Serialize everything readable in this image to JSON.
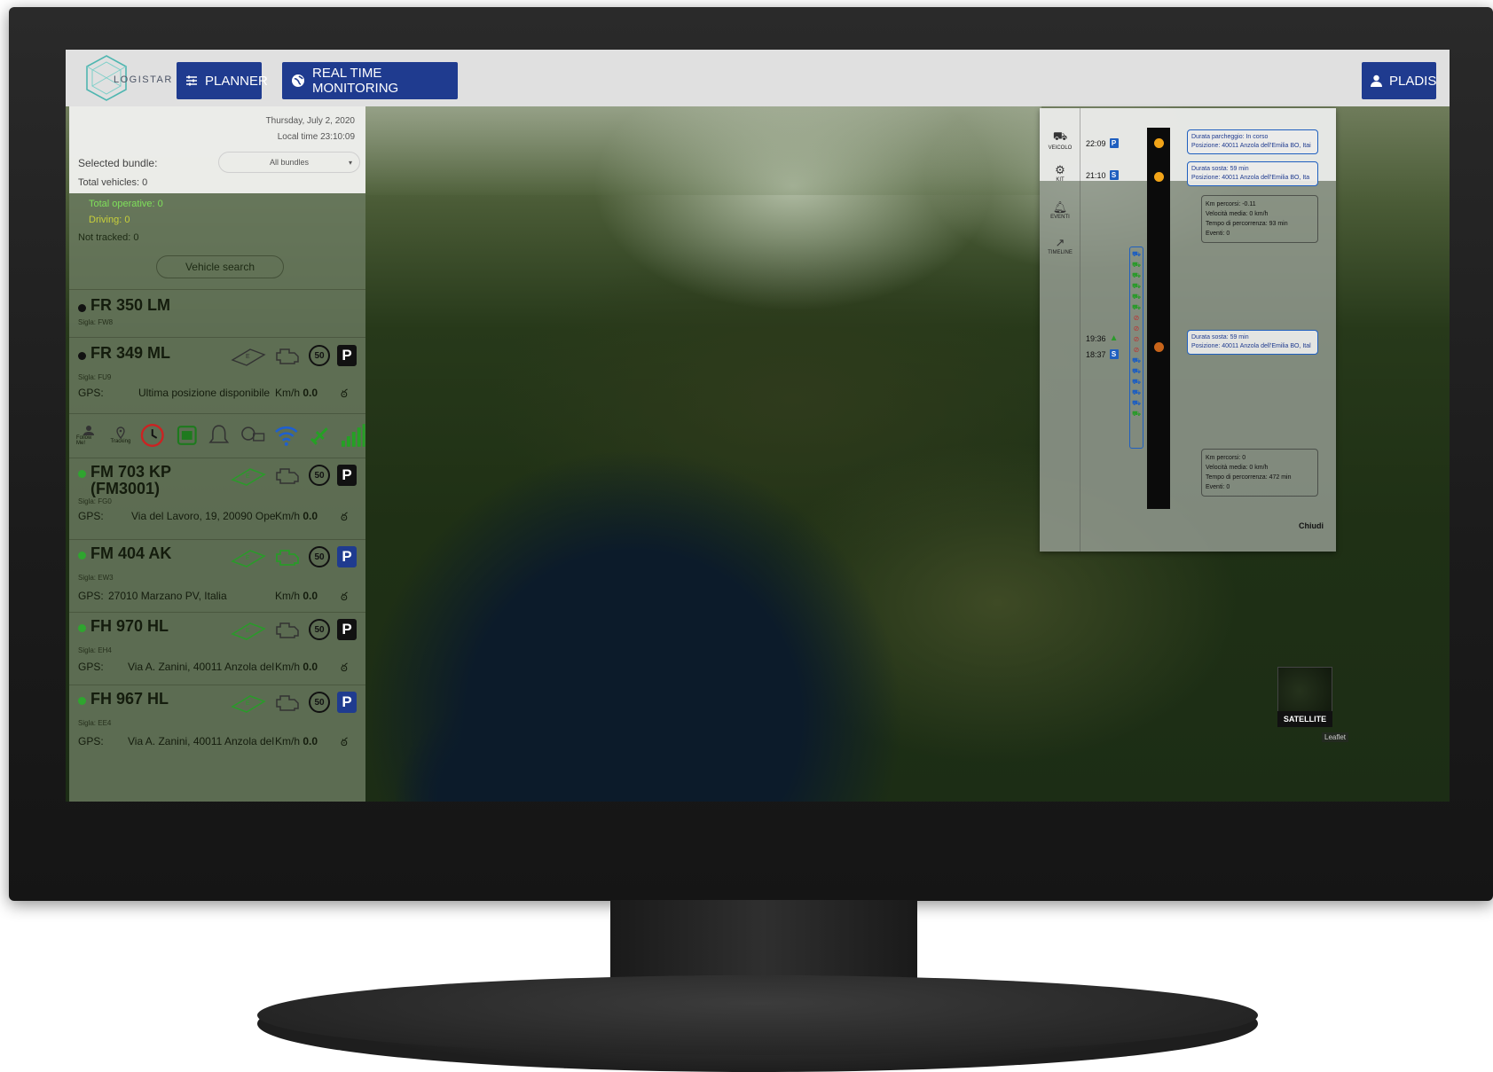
{
  "header": {
    "logo_text": "LOGISTAR",
    "planner_label": "PLANNER",
    "rtm_label": "REAL TIME MONITORING",
    "user_label": "PLADIS"
  },
  "info": {
    "date": "Thursday, July 2, 2020",
    "local_time": "Local time 23:10:09",
    "selected_bundle_label": "Selected bundle:",
    "bundle_value": "All bundles",
    "total_vehicles": "Total vehicles: 0",
    "total_operative": "Total operative: 0",
    "driving": "Driving: 0",
    "not_tracked": "Not tracked: 0",
    "vehicle_search": "Vehicle search"
  },
  "vehicles": [
    {
      "plate": "FR 350 LM",
      "sigla": "Sigla: FW8",
      "status_color": "#111111"
    },
    {
      "plate": "FR 349 ML",
      "sigla": "Sigla: FU9",
      "gps_label": "GPS:",
      "gps_value": "Ultima posizione disponibile",
      "speed_label": "Km/h",
      "speed_value": "0.0",
      "speed_limit": "50",
      "status_color": "#111111"
    },
    {
      "plate": "FM 703 KP",
      "plate_line2": "(FM3001)",
      "sigla": "Sigla: FG0",
      "gps_label": "GPS:",
      "gps_value": "Via del Lavoro, 19, 20090 Ope",
      "speed_label": "Km/h",
      "speed_value": "0.0",
      "speed_limit": "50",
      "status_color": "#2fa52f"
    },
    {
      "plate": "FM 404 AK",
      "sigla": "Sigla: EW3",
      "gps_label": "GPS:",
      "gps_value": "27010 Marzano PV, Italia",
      "speed_label": "Km/h",
      "speed_value": "0.0",
      "speed_limit": "50",
      "status_color": "#2fa52f"
    },
    {
      "plate": "FH 970 HL",
      "sigla": "Sigla: EH4",
      "gps_label": "GPS:",
      "gps_value": "Via A. Zanini, 40011 Anzola del",
      "speed_label": "Km/h",
      "speed_value": "0.0",
      "speed_limit": "50",
      "status_color": "#2fa52f"
    },
    {
      "plate": "FH 967 HL",
      "sigla": "Sigla: EE4",
      "gps_label": "GPS:",
      "gps_value": "Via A. Zanini, 40011 Anzola del",
      "speed_label": "Km/h",
      "speed_value": "0.0",
      "speed_limit": "50",
      "status_color": "#2fa52f"
    }
  ],
  "tools": {
    "follow_me": "Follow Me!",
    "tracking": "Tracking"
  },
  "timeline": {
    "nav": {
      "veicolo": "VEICOLO",
      "kit": "KIT",
      "eventi": "EVENTI",
      "timeline": "TIMELINE"
    },
    "entries": [
      {
        "time": "22:09",
        "badge": "P"
      },
      {
        "time": "21:10",
        "badge": "S"
      },
      {
        "time": "19:36",
        "badge": "▲"
      },
      {
        "time": "18:37",
        "badge": "S"
      }
    ],
    "box1_l1": "Durata parcheggio: In corso",
    "box1_l2": "Posizione: 40011 Anzola dell'Emilia BO, Itai",
    "box2_l1": "Durata sosta: 59 min",
    "box2_l2": "Posizione: 40011 Anzola dell'Emilia BO, Ita",
    "stat1_km": "Km percorsi: -0.11",
    "stat1_speed": "Velocità media: 0 km/h",
    "stat1_time": "Tempo di percorrenza: 93 min",
    "stat1_events": "Eventi: 0",
    "box3_l1": "Durata sosta: 59 min",
    "box3_l2": "Posizione: 40011 Anzola dell'Emilia BO, Ital",
    "stat2_km": "Km percorsi: 0",
    "stat2_speed": "Velocità media: 0 km/h",
    "stat2_time": "Tempo di percorrenza: 472 min",
    "stat2_events": "Eventi: 0",
    "close_label": "Chiudi"
  },
  "map": {
    "satellite_label": "SATELLITE",
    "attribution": "Leaflet"
  },
  "colors": {
    "nav_button": "#1f3b8f",
    "topbar": "#e0e0e0",
    "operative": "#7fe05a",
    "driving": "#c9d03a"
  }
}
